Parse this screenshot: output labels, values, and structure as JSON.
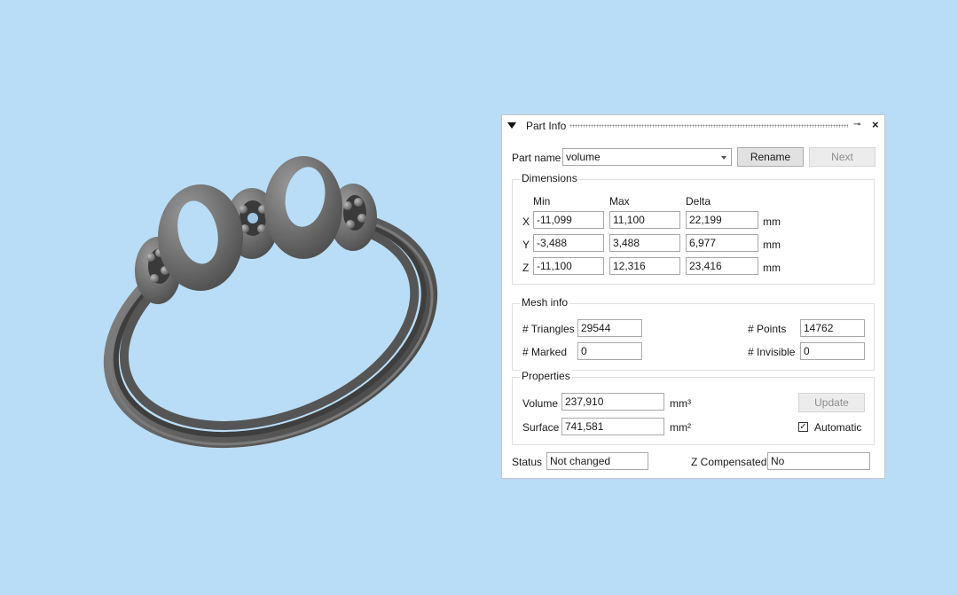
{
  "panel": {
    "title": "Part Info",
    "pin_glyph": "⊸",
    "close_glyph": "×"
  },
  "part_name": {
    "label": "Part name",
    "value": "volume",
    "rename_label": "Rename",
    "next_label": "Next"
  },
  "dimensions": {
    "title": "Dimensions",
    "headers": [
      "Min",
      "Max",
      "Delta"
    ],
    "unit": "mm",
    "rows": [
      {
        "axis": "X",
        "min": "-11,099",
        "max": "11,100",
        "delta": "22,199"
      },
      {
        "axis": "Y",
        "min": "-3,488",
        "max": "3,488",
        "delta": "6,977"
      },
      {
        "axis": "Z",
        "min": "-11,100",
        "max": "12,316",
        "delta": "23,416"
      }
    ]
  },
  "mesh_info": {
    "title": "Mesh info",
    "triangles_label": "# Triangles",
    "triangles": "29544",
    "points_label": "# Points",
    "points": "14762",
    "marked_label": "# Marked",
    "marked": "0",
    "invisible_label": "# Invisible",
    "invisible": "0"
  },
  "properties": {
    "title": "Properties",
    "volume_label": "Volume",
    "volume": "237,910",
    "volume_unit": "mm³",
    "surface_label": "Surface",
    "surface": "741,581",
    "surface_unit": "mm²",
    "update_label": "Update",
    "automatic_label": "Automatic",
    "automatic_checked": true
  },
  "status": {
    "label": "Status",
    "value": "Not changed",
    "z_comp_label": "Z Compensated",
    "z_comp_value": "No"
  },
  "colors": {
    "background": "#b9ddf6",
    "model": "#6f6f6f"
  }
}
